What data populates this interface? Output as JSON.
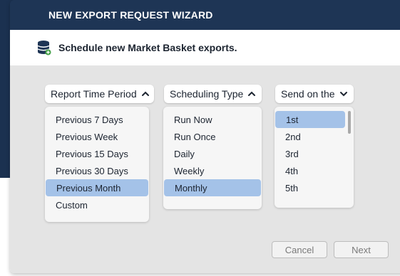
{
  "wizard": {
    "title": "NEW EXPORT REQUEST WIZARD",
    "subtitle": "Schedule new Market Basket exports.",
    "icon": "database-add-icon"
  },
  "columns": [
    {
      "label": "Report Time Period",
      "chevron": "chevron-up-icon",
      "items": [
        "Previous 7 Days",
        "Previous Week",
        "Previous 15 Days",
        "Previous 30 Days",
        "Previous Month",
        "Custom"
      ],
      "selected": "Previous Month"
    },
    {
      "label": "Scheduling Type",
      "chevron": "chevron-up-icon",
      "items": [
        "Run Now",
        "Run Once",
        "Daily",
        "Weekly",
        "Monthly"
      ],
      "selected": "Monthly"
    },
    {
      "label": "Send on the",
      "chevron": "chevron-down-icon",
      "items": [
        "1st",
        "2nd",
        "3rd",
        "4th",
        "5th"
      ],
      "selected": "1st"
    }
  ],
  "buttons": {
    "cancel": "Cancel",
    "next": "Next"
  },
  "colors": {
    "title_bar": "#1e3555",
    "selection": "#a4c2e8",
    "content_bg": "#e4e4e4"
  }
}
